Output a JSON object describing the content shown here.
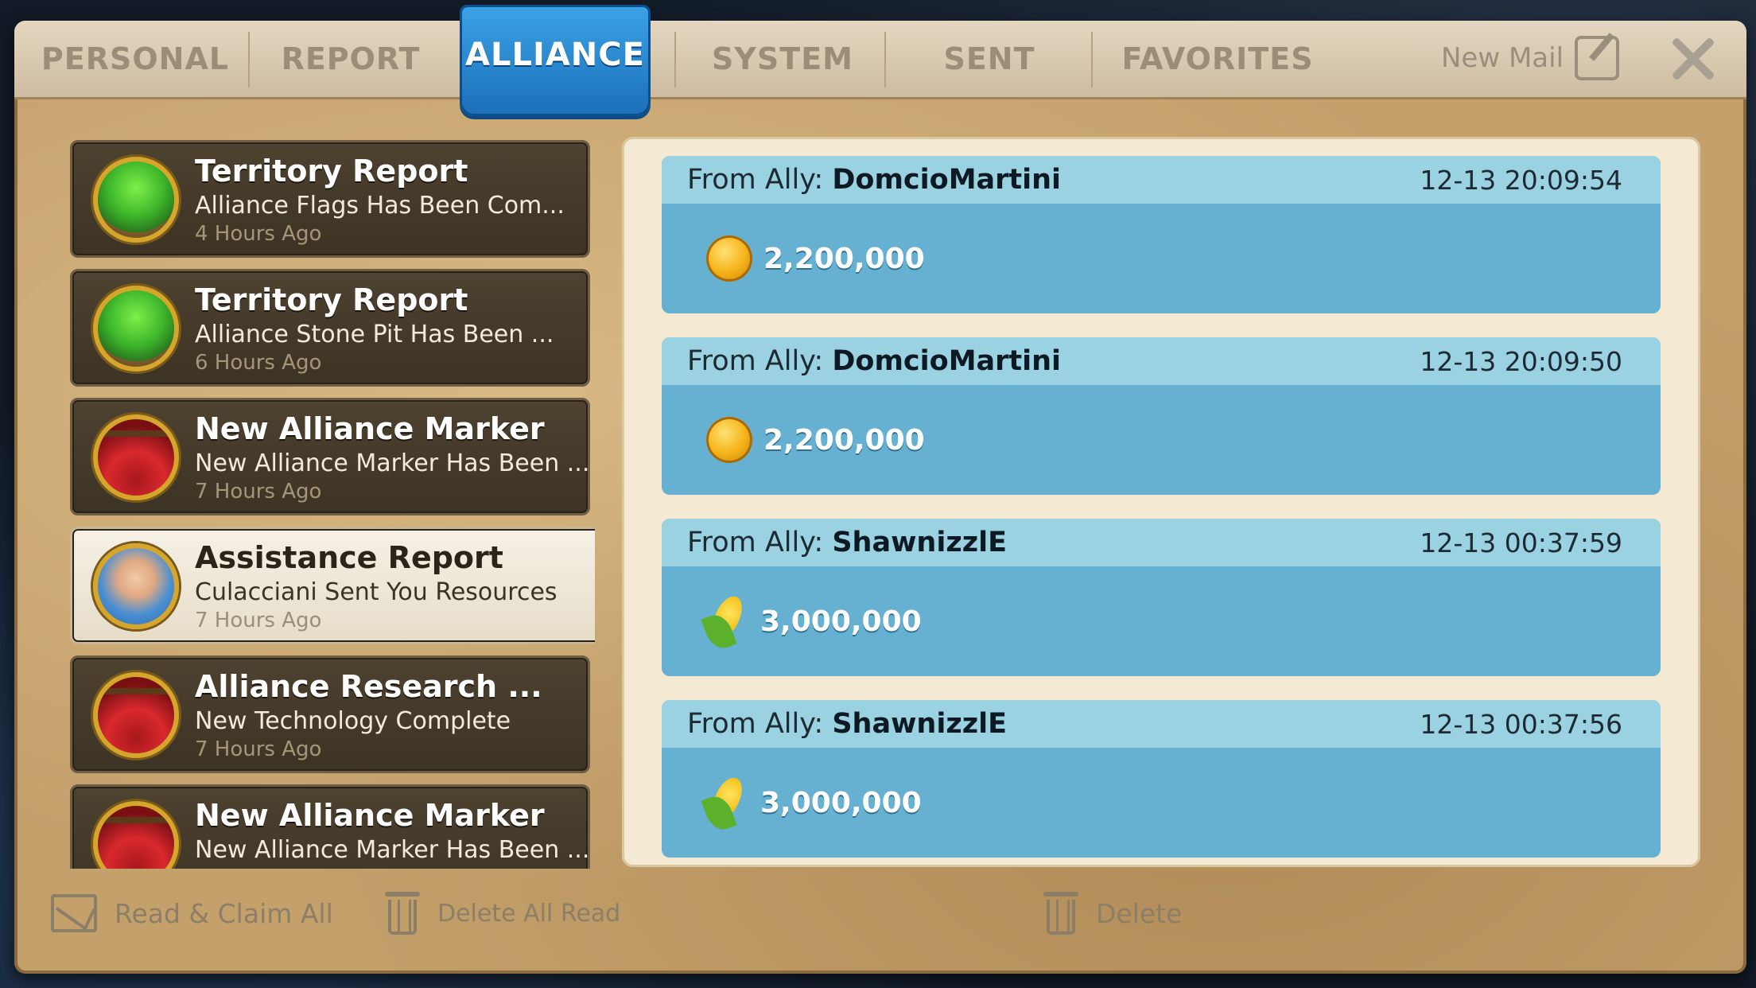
{
  "tabs": [
    {
      "label": "PERSONAL"
    },
    {
      "label": "REPORT"
    },
    {
      "label": "ALLIANCE",
      "active": true
    },
    {
      "label": "SYSTEM"
    },
    {
      "label": "SENT"
    },
    {
      "label": "FAVORITES"
    }
  ],
  "new_mail_label": "New Mail",
  "mail_list": [
    {
      "icon": "territory-icon",
      "title": "Territory Report",
      "subtitle": "Alliance Flags Has Been Com...",
      "time": "4 Hours Ago"
    },
    {
      "icon": "territory-icon",
      "title": "Territory Report",
      "subtitle": "Alliance Stone Pit Has Been ...",
      "time": "6 Hours Ago"
    },
    {
      "icon": "alliance-banner-icon",
      "title": "New Alliance Marker",
      "subtitle": "New Alliance Marker Has Been ...",
      "time": "7 Hours Ago"
    },
    {
      "icon": "advisor-portrait-icon",
      "title": "Assistance Report",
      "subtitle": "Culacciani Sent You Resources",
      "time": "7 Hours Ago",
      "selected": true
    },
    {
      "icon": "alliance-banner-icon",
      "title": "Alliance Research ...",
      "subtitle": "New Technology Complete",
      "time": "7 Hours Ago"
    },
    {
      "icon": "alliance-banner-icon",
      "title": "New Alliance Marker",
      "subtitle": "New Alliance Marker Has Been ...",
      "time": ""
    }
  ],
  "detail": {
    "from_prefix": "From Ally:",
    "entries": [
      {
        "sender": "DomcioMartini",
        "timestamp": "12-13 20:09:54",
        "resource": "gold-coin-icon",
        "amount": "2,200,000"
      },
      {
        "sender": "DomcioMartini",
        "timestamp": "12-13 20:09:50",
        "resource": "gold-coin-icon",
        "amount": "2,200,000"
      },
      {
        "sender": "ShawnizzlE",
        "timestamp": "12-13 00:37:59",
        "resource": "corn-food-icon",
        "amount": "3,000,000"
      },
      {
        "sender": "ShawnizzlE",
        "timestamp": "12-13 00:37:56",
        "resource": "corn-food-icon",
        "amount": "3,000,000"
      }
    ]
  },
  "bottom": {
    "read_claim_all": "Read & Claim All",
    "delete_all_read": "Delete All Read",
    "delete": "Delete"
  }
}
